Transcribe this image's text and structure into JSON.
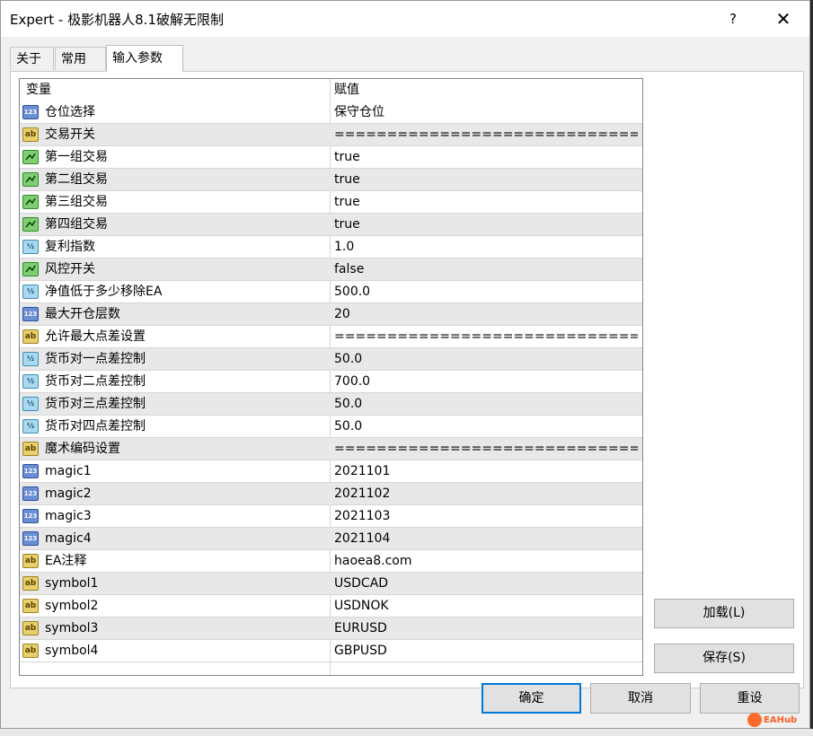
{
  "window": {
    "title": "Expert - 极影机器人8.1破解无限制",
    "help_label": "?",
    "close_label": "✕"
  },
  "tabs": [
    {
      "label": "关于",
      "active": false
    },
    {
      "label": "常用",
      "active": false
    },
    {
      "label": "输入参数",
      "active": true
    }
  ],
  "grid": {
    "header": {
      "name": "变量",
      "value": "赋值"
    },
    "rows": [
      {
        "icon": "int",
        "name": "仓位选择",
        "value": "保守仓位"
      },
      {
        "icon": "str",
        "name": "交易开关",
        "value": "=============================="
      },
      {
        "icon": "bool",
        "name": "第一组交易",
        "value": "true"
      },
      {
        "icon": "bool",
        "name": "第二组交易",
        "value": "true"
      },
      {
        "icon": "bool",
        "name": "第三组交易",
        "value": "true"
      },
      {
        "icon": "bool",
        "name": "第四组交易",
        "value": "true"
      },
      {
        "icon": "dbl",
        "name": "复利指数",
        "value": "1.0"
      },
      {
        "icon": "bool",
        "name": "风控开关",
        "value": "false"
      },
      {
        "icon": "dbl",
        "name": "净值低于多少移除EA",
        "value": "500.0"
      },
      {
        "icon": "int",
        "name": "最大开仓层数",
        "value": "20"
      },
      {
        "icon": "str",
        "name": "允许最大点差设置",
        "value": "=============================="
      },
      {
        "icon": "dbl",
        "name": "货币对一点差控制",
        "value": "50.0"
      },
      {
        "icon": "dbl",
        "name": "货币对二点差控制",
        "value": "700.0"
      },
      {
        "icon": "dbl",
        "name": "货币对三点差控制",
        "value": "50.0"
      },
      {
        "icon": "dbl",
        "name": "货币对四点差控制",
        "value": "50.0"
      },
      {
        "icon": "str",
        "name": "魔术编码设置",
        "value": "=============================="
      },
      {
        "icon": "int",
        "name": "magic1",
        "value": "2021101"
      },
      {
        "icon": "int",
        "name": "magic2",
        "value": "2021102"
      },
      {
        "icon": "int",
        "name": "magic3",
        "value": "2021103"
      },
      {
        "icon": "int",
        "name": "magic4",
        "value": "2021104"
      },
      {
        "icon": "str",
        "name": "EA注释",
        "value": "haoea8.com"
      },
      {
        "icon": "str",
        "name": "symbol1",
        "value": "USDCAD"
      },
      {
        "icon": "str",
        "name": "symbol2",
        "value": "USDNOK"
      },
      {
        "icon": "str",
        "name": "symbol3",
        "value": "EURUSD"
      },
      {
        "icon": "str",
        "name": "symbol4",
        "value": "GBPUSD"
      }
    ]
  },
  "icon_labels": {
    "int": "123",
    "str": "ab",
    "dbl": "½",
    "bool": ""
  },
  "buttons": {
    "load": "加载(L)",
    "save": "保存(S)",
    "ok": "确定",
    "cancel": "取消",
    "reset": "重设"
  },
  "watermark": {
    "text": "EAHub"
  },
  "colors": {
    "focus_border": "#0078d7",
    "alt_row": "#e8e8e8"
  }
}
